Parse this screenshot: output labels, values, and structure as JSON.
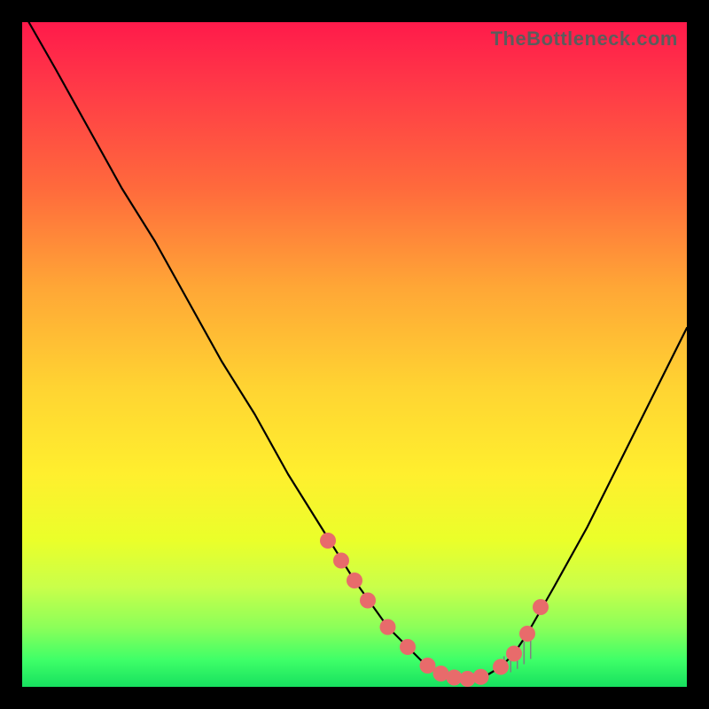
{
  "attribution": "TheBottleneck.com",
  "chart_data": {
    "type": "line",
    "title": "",
    "xlabel": "",
    "ylabel": "",
    "xlim": [
      0,
      100
    ],
    "ylim": [
      0,
      100
    ],
    "grid": false,
    "legend": false,
    "series": [
      {
        "name": "bottleneck-curve",
        "x": [
          1,
          5,
          10,
          15,
          20,
          25,
          30,
          35,
          40,
          45,
          50,
          55,
          56,
          58,
          60,
          62,
          64,
          66,
          68,
          70,
          72,
          74,
          76,
          80,
          85,
          90,
          95,
          100
        ],
        "y": [
          100,
          93,
          84,
          75,
          67,
          58,
          49,
          41,
          32,
          24,
          16,
          9,
          8,
          6,
          4,
          2.5,
          1.6,
          1.2,
          1.2,
          1.8,
          3,
          5,
          8,
          15,
          24,
          34,
          44,
          54
        ]
      }
    ],
    "markers": {
      "name": "highlight-points",
      "color": "#e86b6b",
      "radius_px": 9,
      "x": [
        46,
        48,
        50,
        52,
        55,
        58,
        61,
        63,
        65,
        67,
        69,
        72,
        74,
        76,
        78
      ],
      "y": [
        22,
        19,
        16,
        13,
        9,
        6,
        3.2,
        2.0,
        1.4,
        1.2,
        1.5,
        3,
        5,
        8,
        12
      ]
    },
    "tick_marks": {
      "name": "fine-ticks",
      "color": "#808080",
      "x": [
        72.5,
        73.5,
        74.5,
        75.5,
        76.5
      ],
      "y_from": [
        2.0,
        2.2,
        2.7,
        3.4,
        4.2
      ],
      "y_to": [
        4.6,
        5.0,
        5.8,
        6.8,
        7.8
      ]
    }
  },
  "colors": {
    "curve": "#000000",
    "marker": "#e86b6b",
    "background_top": "#ff1a4b",
    "background_mid": "#ffef2e",
    "background_bottom": "#17e05f",
    "frame": "#000000"
  }
}
